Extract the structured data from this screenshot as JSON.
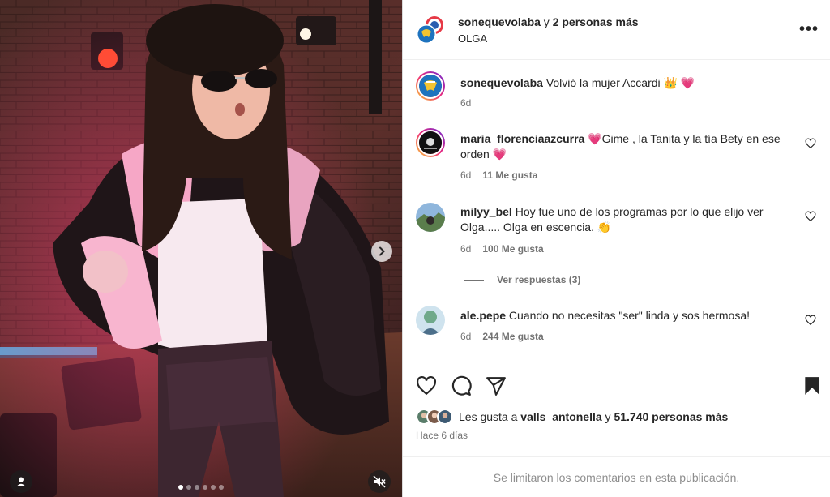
{
  "media": {
    "dots_total": 6,
    "active_dot": 1,
    "next_icon": "chevron-right-icon",
    "mute_icon": "speaker-muted-icon",
    "tag_icon": "person-icon"
  },
  "header": {
    "username": "sonequevolaba",
    "connector": " y ",
    "others": "2 personas más",
    "subtitle": "OLGA",
    "more_label": "•••"
  },
  "comments": [
    {
      "username": "sonequevolaba",
      "text": "Volvió la mujer Accardi 👑 💗",
      "time": "6d",
      "likes": ""
    },
    {
      "username": "maria_florenciaazcurra",
      "text": "💗Gime , la Tanita y la tía Bety en ese orden 💗",
      "time": "6d",
      "likes": "11 Me gusta"
    },
    {
      "username": "milyy_bel",
      "text": "Hoy fue uno de los programas por lo que elijo ver Olga..... Olga en escencia. 👏",
      "time": "6d",
      "likes": "100 Me gusta"
    },
    {
      "username": "ale.pepe",
      "text": "Cuando no necesitas \"ser\" linda y sos hermosa!",
      "time": "6d",
      "likes": "244 Me gusta"
    }
  ],
  "replies_label": "Ver respuestas (3)",
  "likes": {
    "prefix": "Les gusta a ",
    "user": "valls_antonella",
    "connector": " y ",
    "count": "51.740 personas más"
  },
  "time_ago": "Hace 6 días",
  "footer_text": "Se limitaron los comentarios en esta publicación.",
  "colors": {
    "ring_gradient": [
      "#f9ce34",
      "#ee2a7b",
      "#6228d7"
    ],
    "muted_text": "#737373",
    "border": "#dbdbdb"
  }
}
